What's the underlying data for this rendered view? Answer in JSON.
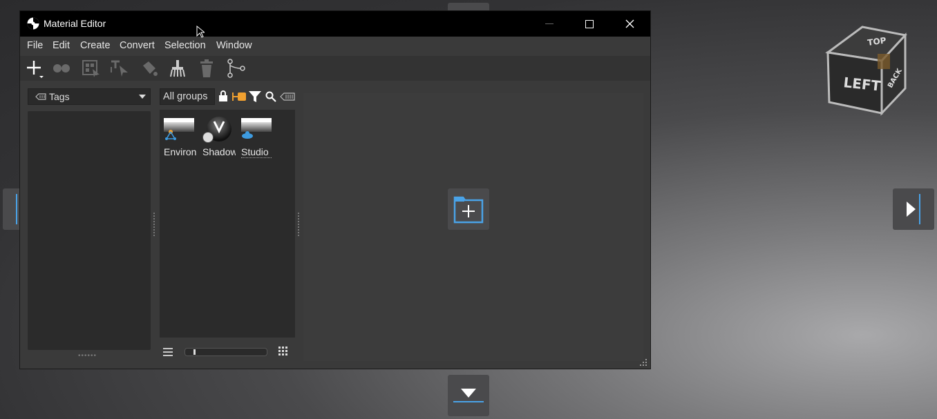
{
  "window": {
    "title": "Material Editor",
    "controls": {
      "minimize": "—",
      "maximize": "☐",
      "close": "✕"
    }
  },
  "menu": [
    "File",
    "Edit",
    "Create",
    "Convert",
    "Selection",
    "Window"
  ],
  "toolbar": {
    "icons": [
      "add-icon",
      "material-balls-icon",
      "grid-select-icon",
      "pick-material-icon",
      "paint-bucket-icon",
      "broom-icon",
      "trash-icon",
      "node-graph-icon"
    ]
  },
  "tags": {
    "label": "Tags"
  },
  "groups": {
    "label": "All groups"
  },
  "materials": [
    {
      "label": "Environment",
      "icon": "environment-icon"
    },
    {
      "label": "Shadow",
      "icon": "shadow-material-icon"
    },
    {
      "label": "Studio",
      "icon": "studio-icon"
    }
  ],
  "colors": {
    "accent_orange": "#f0a030",
    "accent_blue": "#3d9be0",
    "title_bg": "#000000",
    "window_bg": "#3a3a3a"
  },
  "viewcube": {
    "top": "TOP",
    "left": "LEFT",
    "back": "BACK"
  }
}
